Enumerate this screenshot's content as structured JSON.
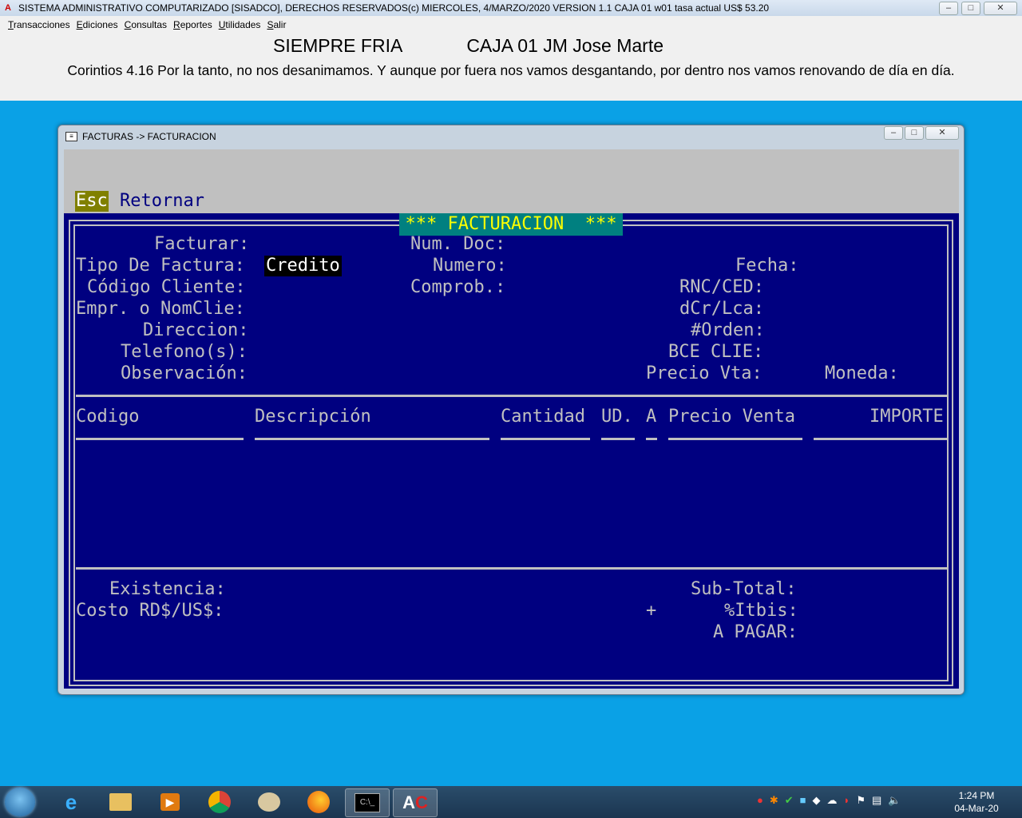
{
  "app": {
    "title": "SISTEMA ADMINISTRATIVO COMPUTARIZADO [SISADCO], DERECHOS RESERVADOS(c)  MIERCOLES,  4/MARZO/2020    VERSION 1.1     CAJA 01     w01     tasa actual US$ 53.20",
    "minimize": "–",
    "maximize": "□",
    "close": "✕"
  },
  "menu": [
    "Transacciones",
    "Ediciones",
    "Consultas",
    "Reportes",
    "Utilidades",
    "Salir"
  ],
  "header": {
    "company": "SIEMPRE FRIA",
    "caja": "CAJA 01  JM Jose Marte",
    "verse": "Corintios 4.16 Por la tanto, no nos desanimamos. Y aunque por fuera nos vamos desgantando, por dentro nos vamos renovando de día en día."
  },
  "window": {
    "title": "FACTURAS -> FACTURACION",
    "esc_key": "Esc",
    "esc_label": "Retornar",
    "form_title": "*** FACTURACION  ***"
  },
  "form": {
    "facturar": "Facturar:",
    "tipo_factura": "Tipo De Factura:",
    "tipo_factura_value": "Credito",
    "codigo_cliente": "Código Cliente:",
    "empresa": "Empr. o NomClie:",
    "direccion": "Direccion:",
    "telefono": "Telefono(s):",
    "observacion": "Observación:",
    "num_doc": "Num. Doc:",
    "numero": "Numero:",
    "comprob": "Comprob.:",
    "fecha": "Fecha:",
    "rnc": "RNC/CED:",
    "dcr": "dCr/Lca:",
    "orden": "#Orden:",
    "bce": "BCE CLIE:",
    "precio_vta": "Precio Vta:",
    "moneda": "Moneda:"
  },
  "table": {
    "codigo": "Codigo",
    "descripcion": "Descripción",
    "cantidad": "Cantidad",
    "ud": "UD.",
    "a": "A",
    "precio_venta": "Precio Venta",
    "importe": "IMPORTE"
  },
  "footer": {
    "existencia": "Existencia:",
    "costo": "Costo RD$/US$:",
    "plus": "+",
    "subtotal": "Sub-Total:",
    "itbis": "%Itbis:",
    "a_pagar": "A PAGAR:"
  },
  "taskbar": {
    "clock_time": "1:24 PM",
    "clock_date": "04-Mar-20",
    "items": [
      "ie-icon",
      "explorer-icon",
      "media-icon",
      "chrome-icon",
      "paint-icon",
      "firefox-icon",
      "cmd-icon",
      "sisadco-icon"
    ]
  }
}
